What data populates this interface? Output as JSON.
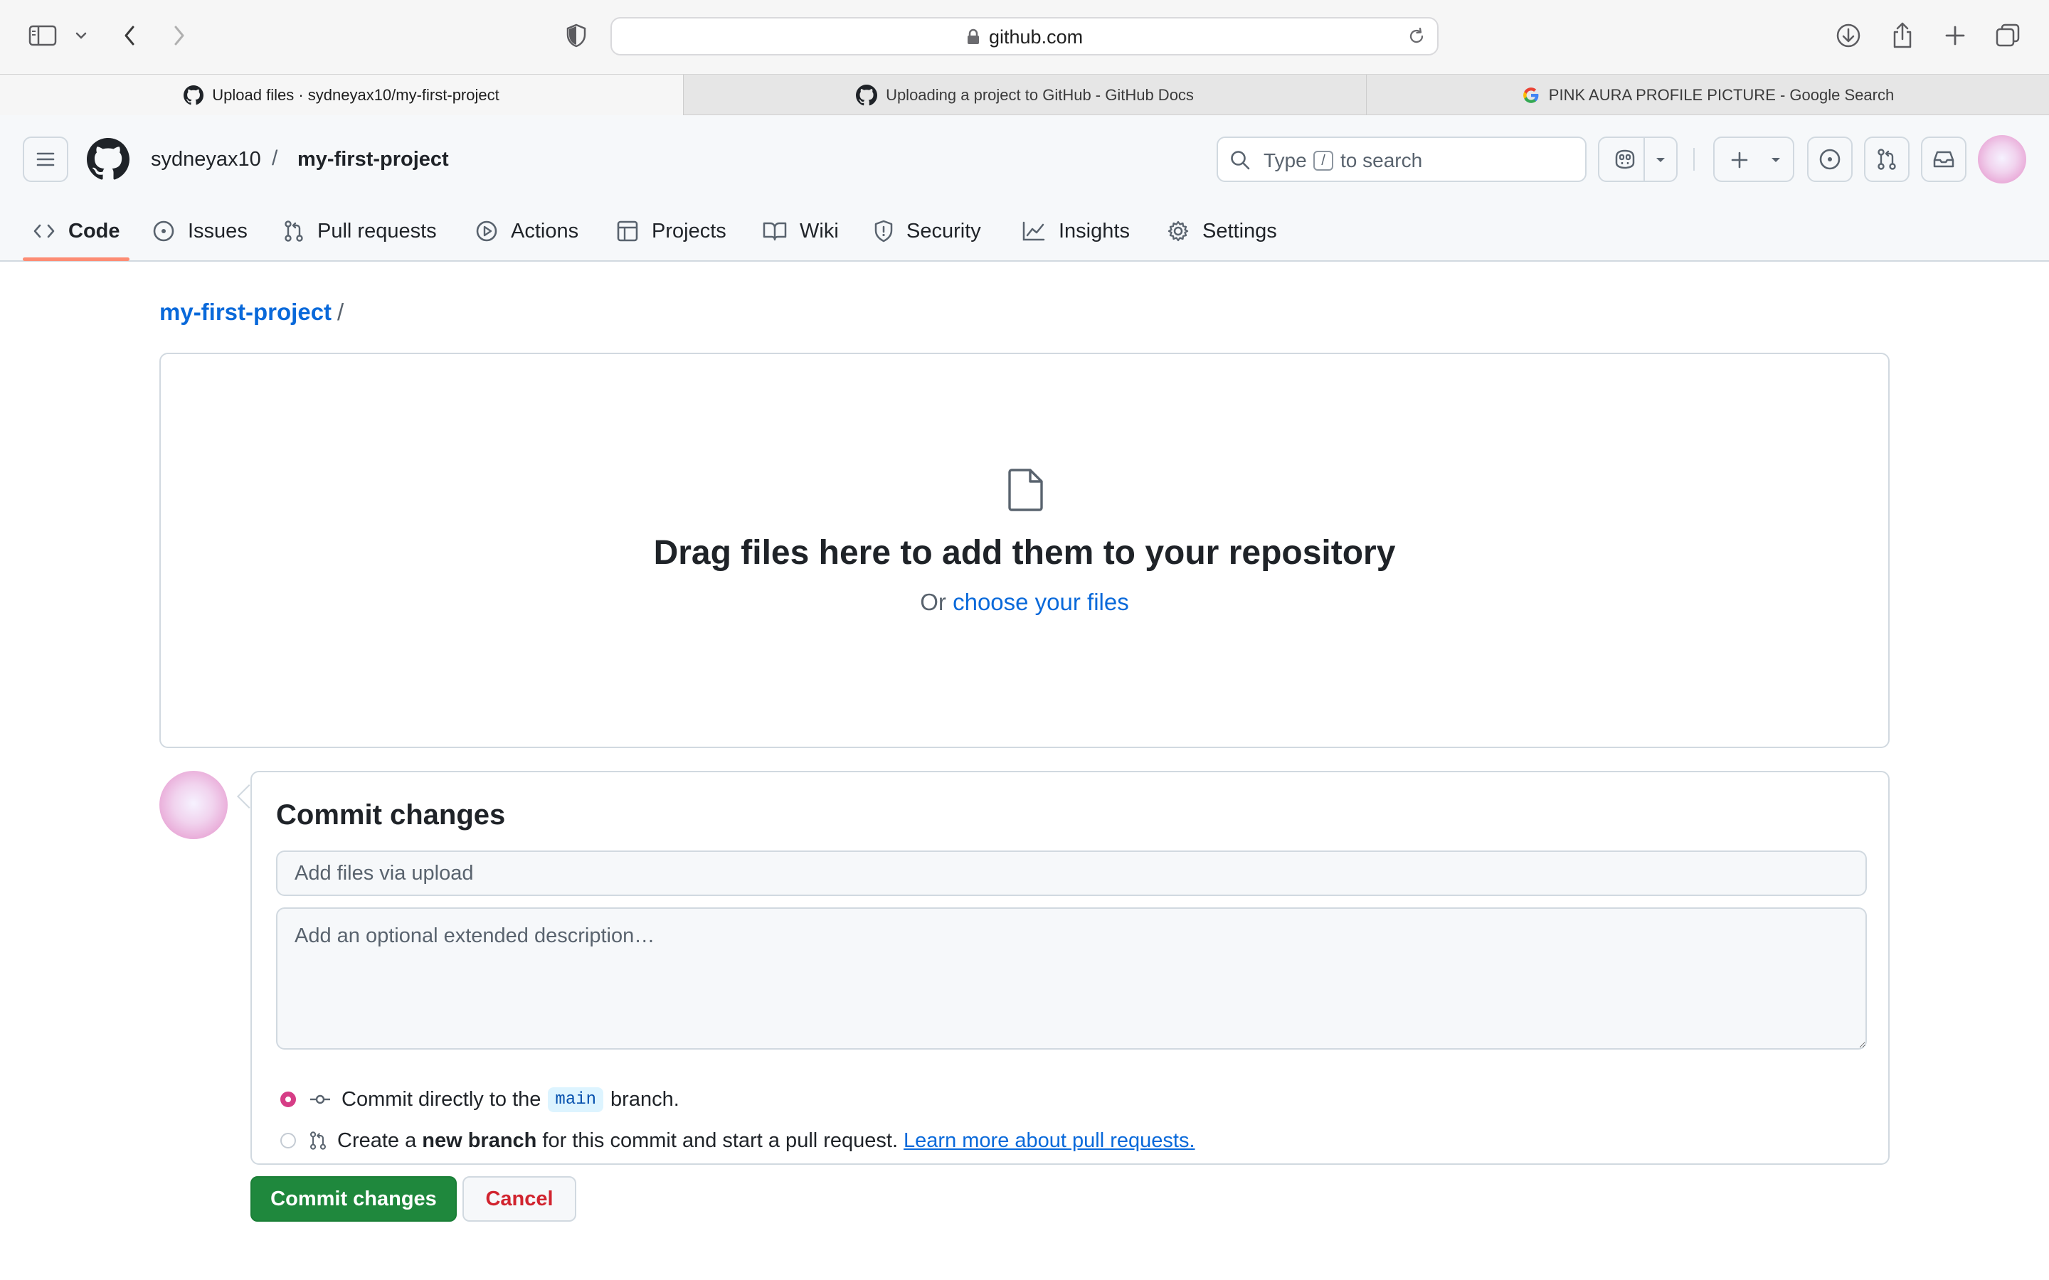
{
  "browser": {
    "url": "github.com",
    "tabs": [
      {
        "title": "Upload files · sydneyax10/my-first-project",
        "active": true,
        "favicon": "github-icon"
      },
      {
        "title": "Uploading a project to GitHub - GitHub Docs",
        "active": false,
        "favicon": "github-icon"
      },
      {
        "title": "PINK AURA PROFILE PICTURE - Google Search",
        "active": false,
        "favicon": "google-icon"
      }
    ]
  },
  "header": {
    "owner": "sydneyax10",
    "separator": "/",
    "repo": "my-first-project",
    "search": {
      "prefix": "Type",
      "key": "/",
      "suffix": "to search"
    }
  },
  "nav": {
    "items": [
      {
        "label": "Code",
        "icon": "code-icon",
        "selected": true
      },
      {
        "label": "Issues",
        "icon": "issue-icon"
      },
      {
        "label": "Pull requests",
        "icon": "pull-request-icon"
      },
      {
        "label": "Actions",
        "icon": "play-icon"
      },
      {
        "label": "Projects",
        "icon": "table-icon"
      },
      {
        "label": "Wiki",
        "icon": "book-icon"
      },
      {
        "label": "Security",
        "icon": "shield-icon"
      },
      {
        "label": "Insights",
        "icon": "graph-icon"
      },
      {
        "label": "Settings",
        "icon": "gear-icon"
      }
    ]
  },
  "main": {
    "breadcrumb": {
      "repo": "my-first-project",
      "sep": "/"
    },
    "dropzone": {
      "title": "Drag files here to add them to your repository",
      "sub_prefix": "Or",
      "sub_link": "choose your files"
    },
    "commit": {
      "title": "Commit changes",
      "summary_placeholder": "Add files via upload",
      "desc_placeholder": "Add an optional extended description…",
      "option1": {
        "pre": "Commit directly to the",
        "branch": "main",
        "post": "branch.",
        "checked": true
      },
      "option2": {
        "pre": "Create a",
        "bold": "new branch",
        "post": "for this commit and start a pull request.",
        "link": "Learn more about pull requests.",
        "checked": false
      },
      "submit_label": "Commit changes",
      "cancel_label": "Cancel"
    }
  },
  "colors": {
    "primary_button": "#1f883d",
    "link": "#0969da",
    "nav_underline": "#fd8c73",
    "cancel_text": "#d1242f",
    "radio_checked": "#d63d86"
  }
}
